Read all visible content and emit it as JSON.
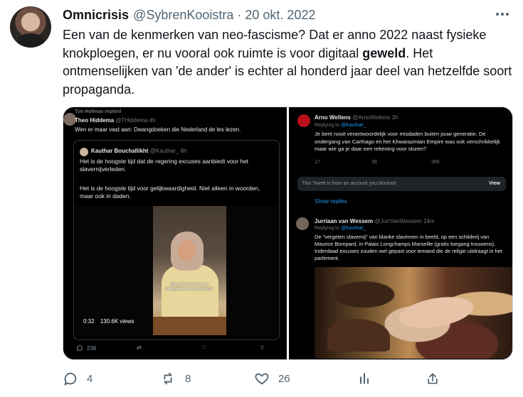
{
  "header": {
    "name": "Omnicrisis",
    "handle": "@SybrenKooistra",
    "separator": "·",
    "date": "20 okt. 2022"
  },
  "tweet": {
    "text_before": "Een van de kenmerken van neo-fascisme? Dat er anno 2022 naast fysieke knokploegen, er nu vooral ook ruimte is voor digitaal ",
    "bold": "geweld",
    "text_after": ". Het ontmenselijken van 'de ander' is echter al honderd jaar deel van hetzelfde soort propaganda."
  },
  "left_panel": {
    "reply_context": "Tim Hofman replied",
    "user": {
      "name": "Theo Hiddema",
      "handle": "@THiddema",
      "time": "4h"
    },
    "text": "Wen er maar vast aan: Dwangdoeken die Nederland de les lezen.",
    "quote": {
      "name": "Kauthar Bouchallikht",
      "handle": "@Kauthar_",
      "time": "8h",
      "p1": "Het is de hoogste tijd dat de regering excuses aanbiedt voor het slavernijverleden.",
      "p2": "Het is de hoogste tijd voor gelijkwaardigheid. Niet alleen in woorden, maar ook in daden.",
      "video": {
        "duration": "0:32",
        "views": "130.6K views",
        "caption": "We zijn het heel veel zo belangrijk want wij de Kauthar"
      }
    },
    "actions": {
      "replies": "236"
    }
  },
  "right_panel": {
    "first": {
      "name": "Arno Wellens",
      "handle": "@ArnoWellens",
      "time": "3h",
      "replying": "Replying to",
      "replying_handle": "@Kauthar_",
      "text": "Je bent nooit verantwoordelijk voor misdaden buiten jouw generatie. De ondergang van Carthago en het Khwarazmian Empire was ook verschrikkelijk maar wie ga je daar een rekening voor sturen?",
      "stats": {
        "replies": "17",
        "retweets": "39",
        "likes": "385"
      }
    },
    "blocked": {
      "text": "This Tweet is from an account you blocked.",
      "view": "View"
    },
    "show_replies": "Show replies",
    "second": {
      "name": "Jurriaan van Wessem",
      "handle": "@JurrVanWessem",
      "time": "24m",
      "replying": "Replying to",
      "replying_handle": "@Kauthar_",
      "text": "De \"vergeten slavernij\" van blanke slavinnen in beeld, op een schilderij van Maurice Bompard, in Palais Longchamps Marseille (gratis toegang trouwens). Inderdaad excuses zouden wel gepast voor iemand die de religie uitdraagt in het parlement."
    }
  },
  "main_actions": {
    "replies": "4",
    "retweets": "8",
    "likes": "26"
  },
  "colors": {
    "text": "#0f1419",
    "muted": "#536471",
    "link": "#1d9bf0",
    "dark": "#000000"
  },
  "icons": [
    "more-icon",
    "reply-icon",
    "retweet-icon",
    "like-icon",
    "analytics-icon",
    "share-icon",
    "avatar"
  ]
}
